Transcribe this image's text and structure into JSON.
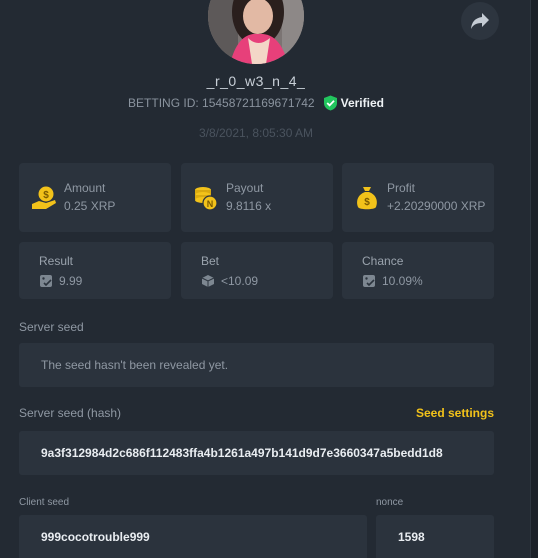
{
  "profile": {
    "username": "_r_0_w3_n_4_",
    "betting_id": "BETTING ID: 15458721169671742",
    "verified_label": "Verified",
    "date": "3/8/2021, 8:05:30 AM"
  },
  "stats": {
    "amount": {
      "label": "Amount",
      "value": "0.25 XRP"
    },
    "payout": {
      "label": "Payout",
      "value": "9.8116 x"
    },
    "profit": {
      "label": "Profit",
      "value": "+2.20290000 XRP"
    }
  },
  "details": {
    "result": {
      "label": "Result",
      "value": "9.99"
    },
    "bet": {
      "label": "Bet",
      "value": "<10.09"
    },
    "chance": {
      "label": "Chance",
      "value": "10.09%"
    }
  },
  "server_seed": {
    "label": "Server seed",
    "value": "The seed hasn't been revealed yet."
  },
  "server_seed_hash": {
    "label": "Server seed (hash)",
    "settings_link": "Seed settings",
    "value": "9a3f312984d2c686f112483ffa4b1261a497b141d9d7e3660347a5bedd1d8"
  },
  "client_seed": {
    "label": "Client seed",
    "value": "999cocotrouble999"
  },
  "nonce": {
    "label": "nonce",
    "value": "1598"
  },
  "icons": {
    "share": "share-icon",
    "verified": "verified-shield-icon",
    "amount": "coin-hand-icon",
    "payout": "coin-stack-icon",
    "profit": "money-bag-icon",
    "result": "dice-check-icon",
    "bet": "dice-icon",
    "chance": "dice-check-icon"
  },
  "colors": {
    "background": "#232a33",
    "card": "#2b333d",
    "accent_yellow": "#f2c21a",
    "verified_green": "#22c55e"
  }
}
